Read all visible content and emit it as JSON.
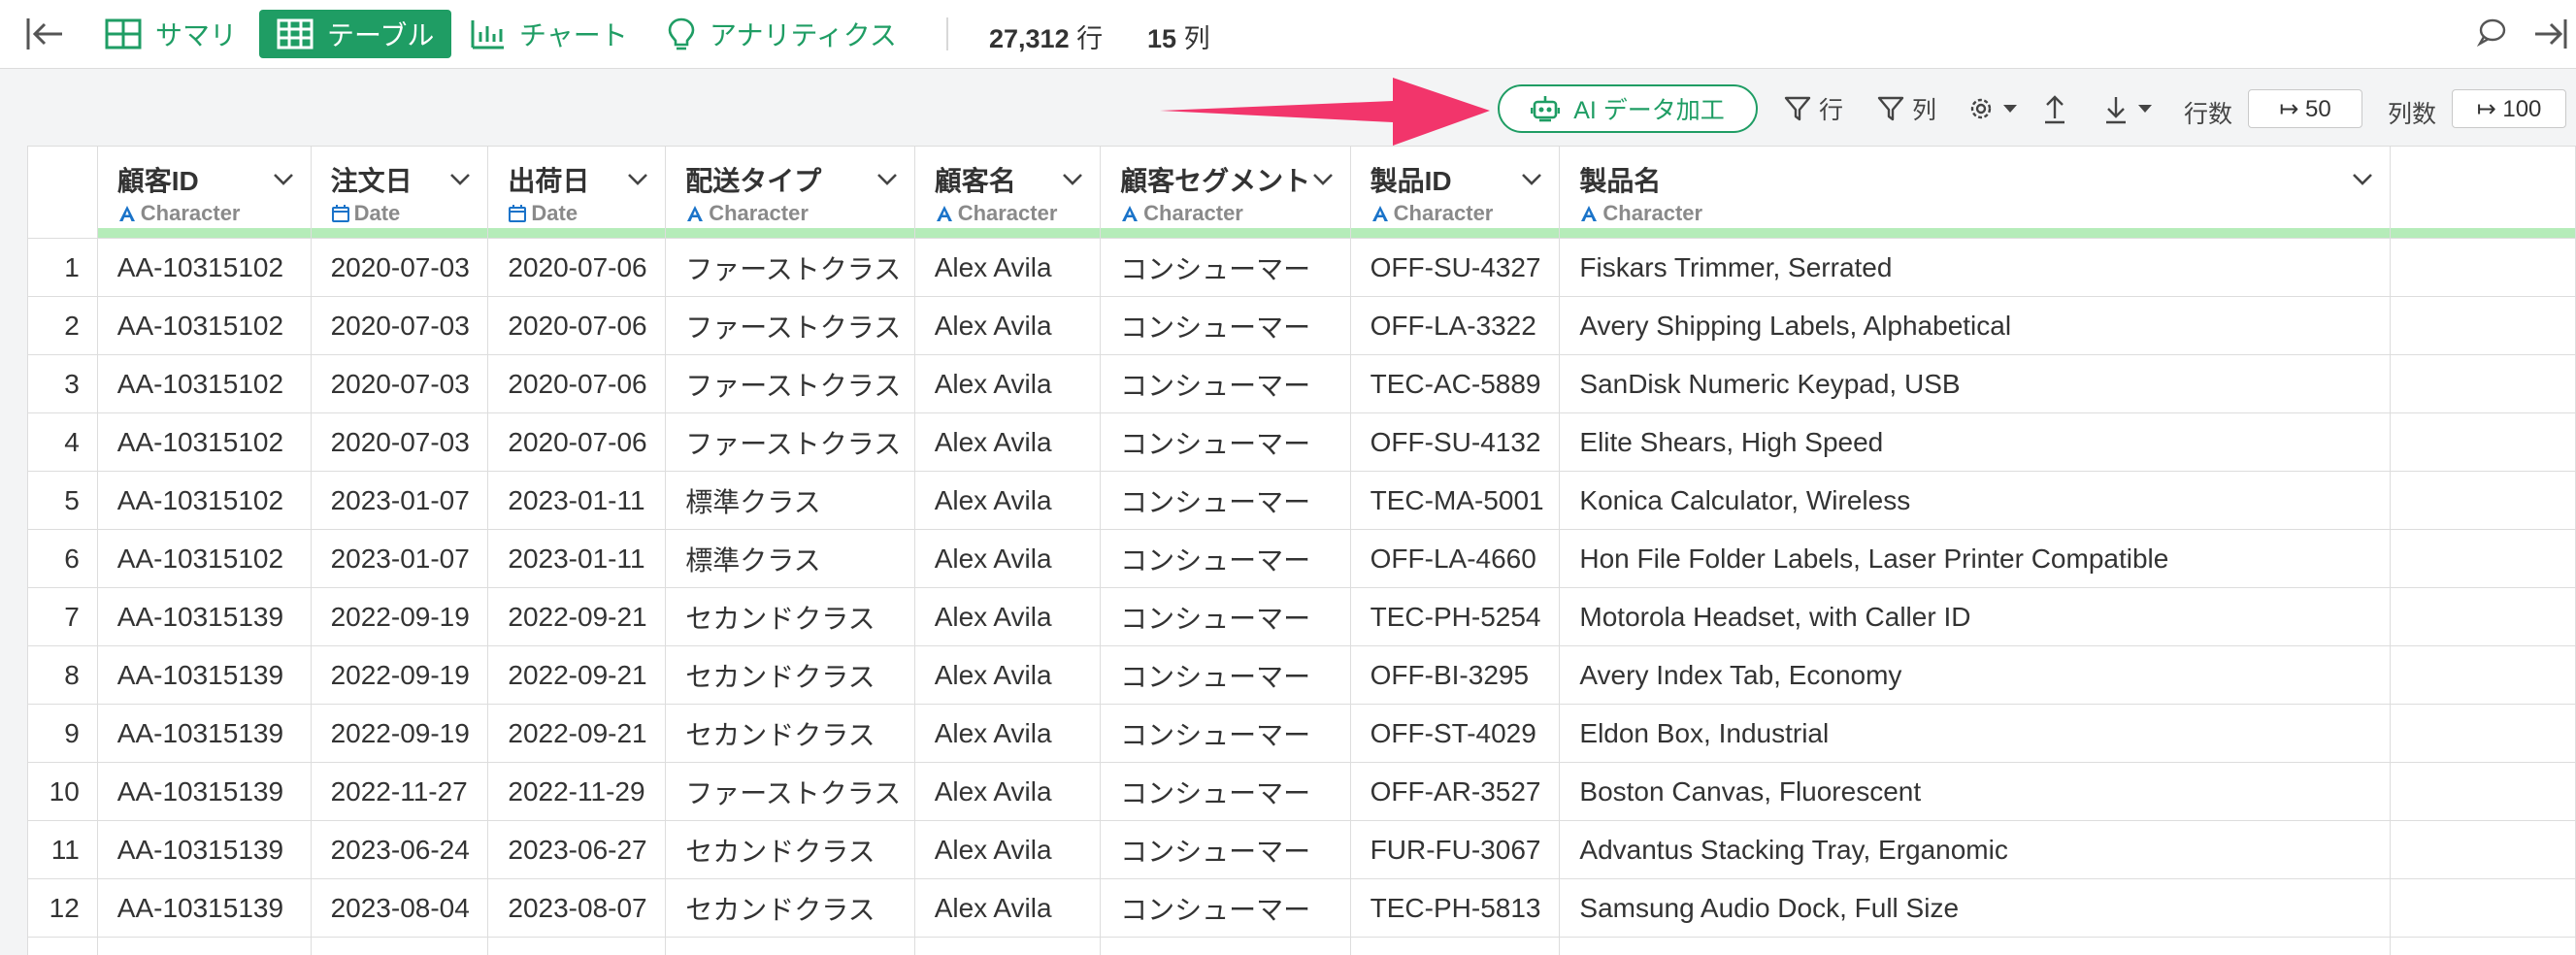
{
  "topbar": {
    "tabs": [
      {
        "label": "サマリ",
        "icon": "summary-icon",
        "active": false
      },
      {
        "label": "テーブル",
        "icon": "table-icon",
        "active": true
      },
      {
        "label": "チャート",
        "icon": "chart-icon",
        "active": false
      },
      {
        "label": "アナリティクス",
        "icon": "lightbulb-icon",
        "active": false
      }
    ],
    "row_count": "27,312",
    "row_unit": "行",
    "col_count": "15",
    "col_unit": "列"
  },
  "toolbar": {
    "ai_label": "AI データ加工",
    "filter_rows_label": "行",
    "filter_cols_label": "列",
    "rows_label": "行数",
    "rows_value": "↦ 50",
    "cols_label": "列数",
    "cols_value": "↦ 100"
  },
  "colors": {
    "accent": "#1f9d64",
    "arrow": "#f2356b",
    "header_strip": "#b5ecb9",
    "type_icon": "#1a73c9"
  },
  "table": {
    "columns": [
      {
        "name": "顧客ID",
        "type": "Character",
        "type_icon": "character-icon"
      },
      {
        "name": "注文日",
        "type": "Date",
        "type_icon": "calendar-icon"
      },
      {
        "name": "出荷日",
        "type": "Date",
        "type_icon": "calendar-icon"
      },
      {
        "name": "配送タイプ",
        "type": "Character",
        "type_icon": "character-icon"
      },
      {
        "name": "顧客名",
        "type": "Character",
        "type_icon": "character-icon"
      },
      {
        "name": "顧客セグメント",
        "type": "Character",
        "type_icon": "character-icon"
      },
      {
        "name": "製品ID",
        "type": "Character",
        "type_icon": "character-icon"
      },
      {
        "name": "製品名",
        "type": "Character",
        "type_icon": "character-icon"
      }
    ],
    "rows": [
      [
        "1",
        "AA-10315102",
        "2020-07-03",
        "2020-07-06",
        "ファーストクラス",
        "Alex Avila",
        "コンシューマー",
        "OFF-SU-4327",
        "Fiskars Trimmer, Serrated"
      ],
      [
        "2",
        "AA-10315102",
        "2020-07-03",
        "2020-07-06",
        "ファーストクラス",
        "Alex Avila",
        "コンシューマー",
        "OFF-LA-3322",
        "Avery Shipping Labels, Alphabetical"
      ],
      [
        "3",
        "AA-10315102",
        "2020-07-03",
        "2020-07-06",
        "ファーストクラス",
        "Alex Avila",
        "コンシューマー",
        "TEC-AC-5889",
        "SanDisk Numeric Keypad, USB"
      ],
      [
        "4",
        "AA-10315102",
        "2020-07-03",
        "2020-07-06",
        "ファーストクラス",
        "Alex Avila",
        "コンシューマー",
        "OFF-SU-4132",
        "Elite Shears, High Speed"
      ],
      [
        "5",
        "AA-10315102",
        "2023-01-07",
        "2023-01-11",
        "標準クラス",
        "Alex Avila",
        "コンシューマー",
        "TEC-MA-5001",
        "Konica Calculator, Wireless"
      ],
      [
        "6",
        "AA-10315102",
        "2023-01-07",
        "2023-01-11",
        "標準クラス",
        "Alex Avila",
        "コンシューマー",
        "OFF-LA-4660",
        "Hon File Folder Labels, Laser Printer Compatible"
      ],
      [
        "7",
        "AA-10315139",
        "2022-09-19",
        "2022-09-21",
        "セカンドクラス",
        "Alex Avila",
        "コンシューマー",
        "TEC-PH-5254",
        "Motorola Headset, with Caller ID"
      ],
      [
        "8",
        "AA-10315139",
        "2022-09-19",
        "2022-09-21",
        "セカンドクラス",
        "Alex Avila",
        "コンシューマー",
        "OFF-BI-3295",
        "Avery Index Tab, Economy"
      ],
      [
        "9",
        "AA-10315139",
        "2022-09-19",
        "2022-09-21",
        "セカンドクラス",
        "Alex Avila",
        "コンシューマー",
        "OFF-ST-4029",
        "Eldon Box, Industrial"
      ],
      [
        "10",
        "AA-10315139",
        "2022-11-27",
        "2022-11-29",
        "ファーストクラス",
        "Alex Avila",
        "コンシューマー",
        "OFF-AR-3527",
        "Boston Canvas, Fluorescent"
      ],
      [
        "11",
        "AA-10315139",
        "2023-06-24",
        "2023-06-27",
        "セカンドクラス",
        "Alex Avila",
        "コンシューマー",
        "FUR-FU-3067",
        "Advantus Stacking Tray, Erganomic"
      ],
      [
        "12",
        "AA-10315139",
        "2023-08-04",
        "2023-08-07",
        "セカンドクラス",
        "Alex Avila",
        "コンシューマー",
        "TEC-PH-5813",
        "Samsung Audio Dock, Full Size"
      ]
    ]
  }
}
